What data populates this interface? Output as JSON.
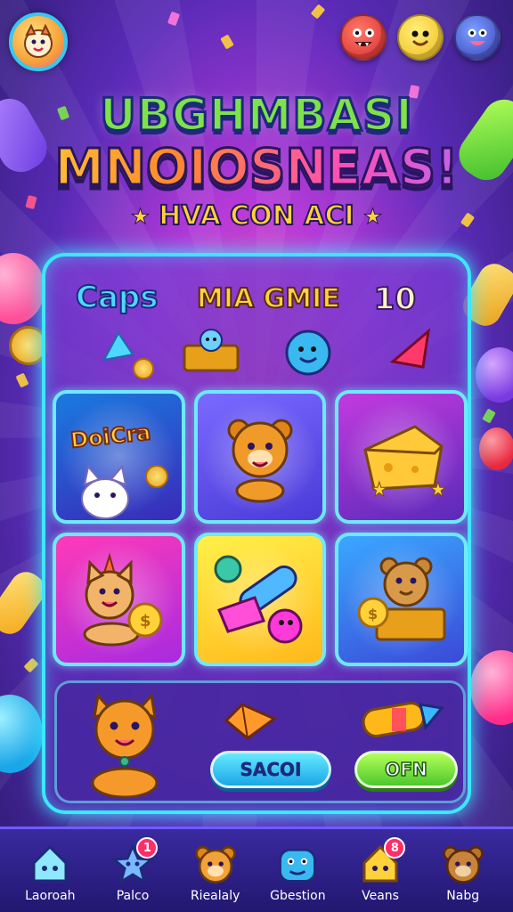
{
  "title": {
    "line1": "UBGHMBASI",
    "line2": "MNOIOSNEAS!",
    "subtitle": "HVA CON ACI"
  },
  "panel": {
    "left_label": "Caps",
    "center_label": "MIA GMIE",
    "score": "10"
  },
  "tiles": [
    {
      "label": "DoiCra"
    },
    {
      "label": ""
    },
    {
      "label": ""
    },
    {
      "label": ""
    },
    {
      "label": ""
    },
    {
      "label": ""
    }
  ],
  "buttons": {
    "secondary_label": "SACOI",
    "primary_label": "OFN"
  },
  "nav": {
    "items": [
      {
        "label": "Laoroah",
        "badge": ""
      },
      {
        "label": "Palco",
        "badge": "1"
      },
      {
        "label": "Riealaly",
        "badge": ""
      },
      {
        "label": "Gbestion",
        "badge": ""
      },
      {
        "label": "Veans",
        "badge": "8"
      },
      {
        "label": "Nabg",
        "badge": ""
      }
    ]
  },
  "icons": {
    "avatar": "cat-avatar-icon",
    "monsters": [
      "red-monster-icon",
      "yellow-monster-icon",
      "blue-monster-icon"
    ]
  },
  "colors": {
    "accent_cyan": "#3ee6ff",
    "title_green": "#7ee24a",
    "gold": "#ffd23a",
    "button_blue": "#1aa6e8",
    "button_green": "#4cc82c",
    "badge_red": "#ff2d6a"
  }
}
